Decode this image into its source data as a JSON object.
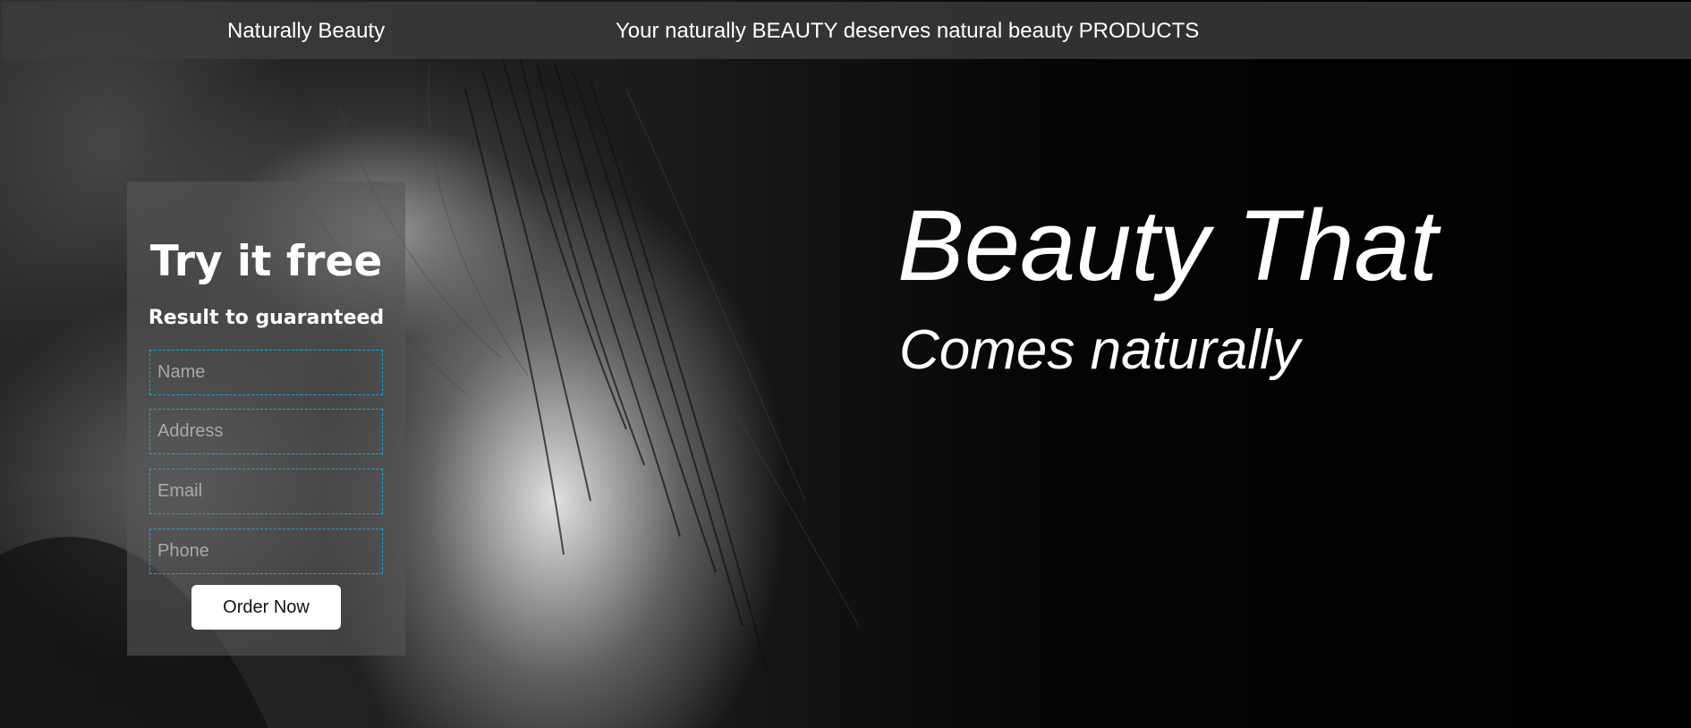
{
  "header": {
    "brand": "Naturally Beauty",
    "tagline": "Your naturally BEAUTY deserves natural beauty PRODUCTS"
  },
  "form": {
    "title": "Try it free",
    "subtitle": "Result to guaranteed",
    "fields": [
      {
        "placeholder": "Name"
      },
      {
        "placeholder": "Address"
      },
      {
        "placeholder": "Email"
      },
      {
        "placeholder": "Phone"
      }
    ],
    "submit_label": "Order Now"
  },
  "hero": {
    "headline": "Beauty That",
    "subheadline": "Comes naturally"
  }
}
